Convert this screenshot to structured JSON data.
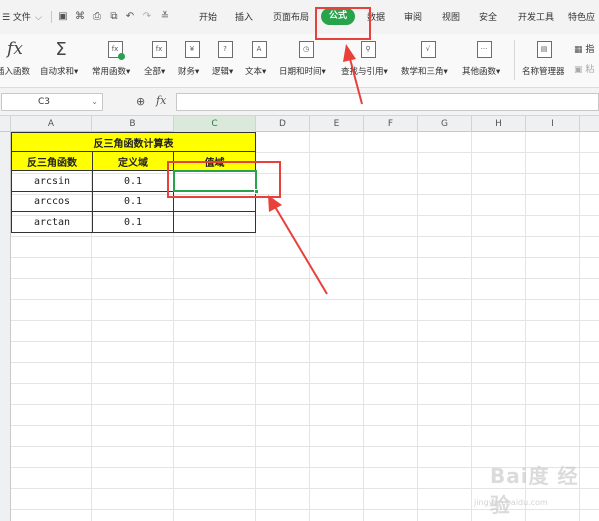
{
  "menubar": {
    "file_label": "☰ 文件",
    "tabs": [
      {
        "label": "开始"
      },
      {
        "label": "插入"
      },
      {
        "label": "页面布局"
      },
      {
        "label": "公式"
      },
      {
        "label": "数据"
      },
      {
        "label": "审阅"
      },
      {
        "label": "视图"
      },
      {
        "label": "安全"
      },
      {
        "label": "开发工具"
      },
      {
        "label": "特色应"
      }
    ],
    "active_tab": "公式",
    "active_color": "#26a34b"
  },
  "ribbon": {
    "items": [
      {
        "label": "插入函数",
        "icon": "fx-icon"
      },
      {
        "label": "自动求和▾",
        "icon": "sigma-icon"
      },
      {
        "label": "常用函数▾",
        "icon": "common-functions-icon"
      },
      {
        "label": "全部▾",
        "icon": "all-functions-icon"
      },
      {
        "label": "财务▾",
        "icon": "finance-icon"
      },
      {
        "label": "逻辑▾",
        "icon": "logic-icon"
      },
      {
        "label": "文本▾",
        "icon": "text-icon"
      },
      {
        "label": "日期和时间▾",
        "icon": "clock-icon"
      },
      {
        "label": "查找与引用▾",
        "icon": "lookup-icon"
      },
      {
        "label": "数学和三角▾",
        "icon": "math-icon"
      },
      {
        "label": "其他函数▾",
        "icon": "more-functions-icon"
      },
      {
        "label": "名称管理器",
        "icon": "name-manager-icon"
      },
      {
        "label": "指",
        "icon": "define-name-icon"
      },
      {
        "label": "粘",
        "icon": "paste-name-icon"
      }
    ]
  },
  "formula_bar": {
    "cell_ref": "C3",
    "fx_label": "fx",
    "formula": ""
  },
  "grid": {
    "columns": [
      "A",
      "B",
      "C",
      "D",
      "E",
      "F",
      "G",
      "H",
      "I"
    ],
    "active_column": "C",
    "table": {
      "title": "反三角函数计算表",
      "headers": [
        "反三角函数",
        "定义域",
        "值域"
      ],
      "rows": [
        {
          "func": "arcsin",
          "domain": "0.1",
          "range": ""
        },
        {
          "func": "arccos",
          "domain": "0.1",
          "range": ""
        },
        {
          "func": "arctan",
          "domain": "0.1",
          "range": ""
        }
      ]
    }
  },
  "watermark": {
    "text": "Bai度 经验",
    "url": "jingyan.baidu.com"
  },
  "colors": {
    "header_fill": "#ffff00",
    "annotation": "#e8413b",
    "selection": "#26a34b"
  }
}
